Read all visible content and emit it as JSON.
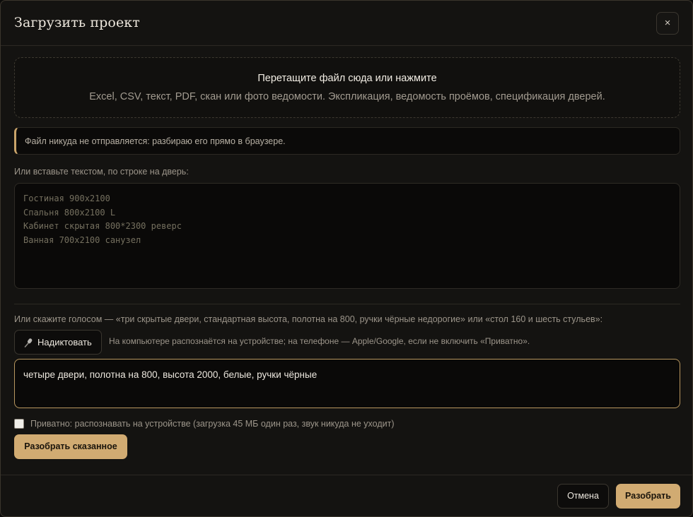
{
  "dialog": {
    "title": "Загрузить проект",
    "close_label": "×"
  },
  "dropzone": {
    "title": "Перетащите файл сюда или нажмите",
    "subtitle": "Excel, CSV, текст, PDF, скан или фото ведомости. Экспликация, ведомость проёмов, спецификация дверей."
  },
  "notice": {
    "text": "Файл никуда не отправляется: разбираю его прямо в браузере."
  },
  "paste": {
    "label": "Или вставьте текстом, по строке на дверь:",
    "placeholder": "Гостиная 900x2100\nСпальня 800x2100 L\nКабинет скрытая 800*2300 реверс\nВанная 700x2100 санузел",
    "value": ""
  },
  "voice": {
    "label": "Или скажите голосом — «три скрытые двери, стандартная высота, полотна на 800, ручки чёрные недорогие» или «стол 160 и шесть стульев»:",
    "dictate_label": "Надиктовать",
    "hint": "На компьютере распознаётся на устройстве; на телефоне — Apple/Google, если не включить «Приватно».",
    "input_value": "четыре двери, полотна на 800, высота 2000, белые, ручки чёрные",
    "private_label": "Приватно: распознавать на устройстве (загрузка 45 МБ один раз, звук никуда не уходит)",
    "private_checked": false,
    "parse_spoken_label": "Разобрать сказанное"
  },
  "footer": {
    "cancel_label": "Отмена",
    "parse_label": "Разобрать"
  },
  "icons": {
    "microphone": "microphone-icon",
    "close": "close-icon"
  },
  "colors": {
    "accent": "#d1ab72",
    "background": "#141311",
    "input_focus_border": "#b8975f"
  }
}
